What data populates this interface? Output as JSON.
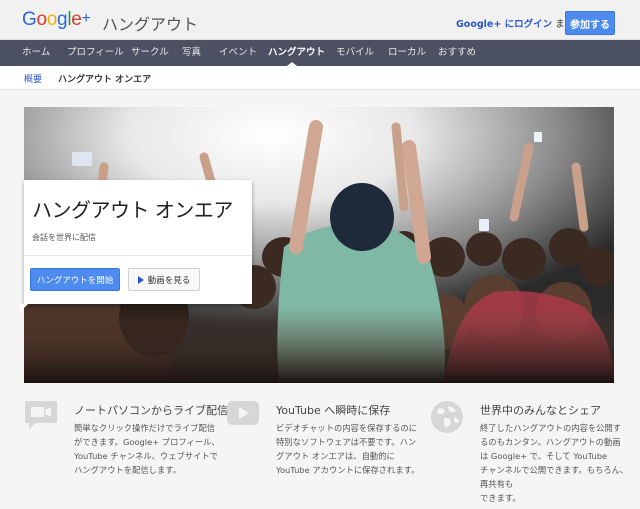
{
  "header": {
    "logo_letters": [
      "G",
      "o",
      "o",
      "g",
      "l",
      "e"
    ],
    "logo_plus": "+",
    "product_name": "ハングアウト",
    "login_link": "Google+ にログイン",
    "login_suffix": " または",
    "join_label": "参加する"
  },
  "nav": {
    "items": [
      "ホーム",
      "プロフィール",
      "サークル",
      "写真",
      "イベント",
      "ハングアウト",
      "モバイル",
      "ローカル",
      "おすすめ"
    ],
    "active_index": 5
  },
  "subnav": {
    "overview": "概要",
    "current": "ハングアウト オンエア"
  },
  "hero": {
    "title": "ハングアウト オンエア",
    "subtitle": "会話を世界に配信",
    "start_button": "ハングアウトを開始",
    "video_button": "動画を見る"
  },
  "features": [
    {
      "icon": "video-camera-icon",
      "title": "ノートパソコンからライブ配信",
      "lines": [
        "簡単なクリック操作だけでライブ配信",
        "ができます。Google+ プロフィール、",
        "YouTube チャンネル、ウェブサイトで",
        "ハングアウトを配信します。"
      ]
    },
    {
      "icon": "youtube-play-icon",
      "title": "YouTube へ瞬時に保存",
      "lines": [
        "ビデオチャットの内容を保存するのに",
        "特別なソフトウェアは不要です。ハン",
        "グアウト オンエアは、自動的に",
        "YouTube アカウントに保存されます。"
      ]
    },
    {
      "icon": "globe-icon",
      "title": "世界中のみんなとシェア",
      "lines": [
        "終了したハングアウトの内容を公開す",
        "るのもカンタン。ハングアウトの動画",
        "は Google+ で、そして YouTube",
        "チャンネルで公開できます。もちろん、",
        "再共有も",
        "できます。"
      ]
    }
  ],
  "colors": {
    "nav_bg": "#4b5163",
    "accent_blue": "#4d8bf0",
    "link_blue": "#2a55c8"
  }
}
